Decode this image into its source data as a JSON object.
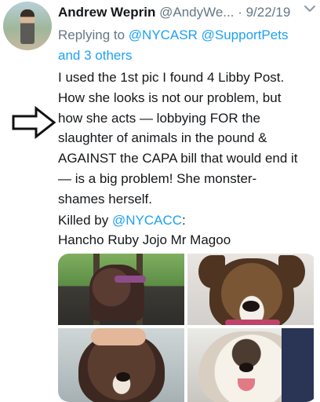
{
  "tweet": {
    "author_name": "Andrew Weprin",
    "author_handle": "@AndyWe...",
    "separator": " · ",
    "date": "9/22/19",
    "reply": {
      "prefix": "Replying to ",
      "mention_1": "@NYCASR",
      "mention_2": "@SupportPets",
      "others": "and 3 others"
    },
    "body_lines": [
      "I used the 1st pic I found 4 Libby Post.",
      "How she looks is not our problem, but",
      "how she acts — lobbying FOR the",
      "slaughter of animals in the pound &",
      "AGAINST the CAPA bill that would end it",
      "— is a big problem! She monster-",
      "shames herself."
    ],
    "killed_prefix": "Killed by ",
    "killed_mention": "@NYCACC",
    "killed_suffix": ":",
    "killed_names": "Hancho Ruby Jojo Mr Magoo"
  },
  "icons": {
    "more": "chevron-down-icon",
    "annotation": "arrow-right-icon"
  },
  "colors": {
    "link": "#1da1f2",
    "secondary_text": "#657786",
    "primary_text": "#14171a"
  }
}
